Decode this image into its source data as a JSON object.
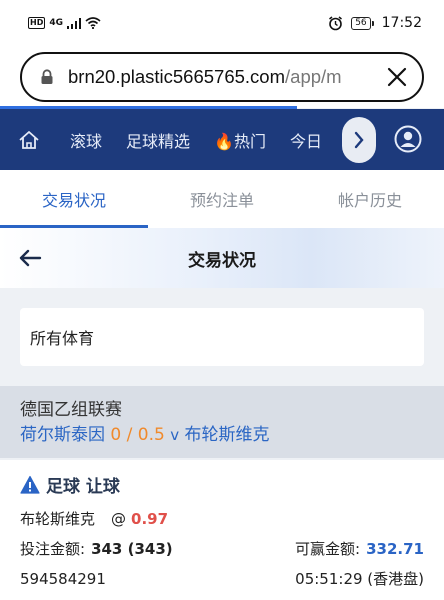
{
  "status_bar": {
    "hd": "HD",
    "network": "4G",
    "battery": "56",
    "time": "17:52"
  },
  "browser": {
    "url_main": "brn20.plastic5665765.com",
    "url_path": "/app/m",
    "load_progress": 0.67
  },
  "nav": {
    "items": [
      "滚球",
      "足球精选",
      "热门",
      "今日"
    ],
    "hot_icon": "fire-icon",
    "colors": {
      "bg": "#1d3a7c",
      "text": "#e6ecf8"
    }
  },
  "tabs": [
    {
      "label": "交易状况",
      "active": true
    },
    {
      "label": "预约注单",
      "active": false
    },
    {
      "label": "帐户历史",
      "active": false
    }
  ],
  "page": {
    "title": "交易状况"
  },
  "filter": {
    "value": "所有体育"
  },
  "league": {
    "name": "德国乙组联赛",
    "home": "荷尔斯泰因",
    "handicap": "0 / 0.5",
    "vs": "v",
    "away": "布轮斯维克"
  },
  "bet": {
    "type": "足球 让球",
    "selection": "布轮斯维克",
    "at": "@",
    "odds": "0.97",
    "stake_label": "投注金额:",
    "stake": "343 (343)",
    "win_label": "可赢金额:",
    "win": "332.71",
    "ticket_id": "594584291",
    "time": "05:51:29 (香港盘)"
  },
  "colors": {
    "accent": "#2a64c5",
    "odds": "#e0504a",
    "handicap": "#f08a2c"
  }
}
